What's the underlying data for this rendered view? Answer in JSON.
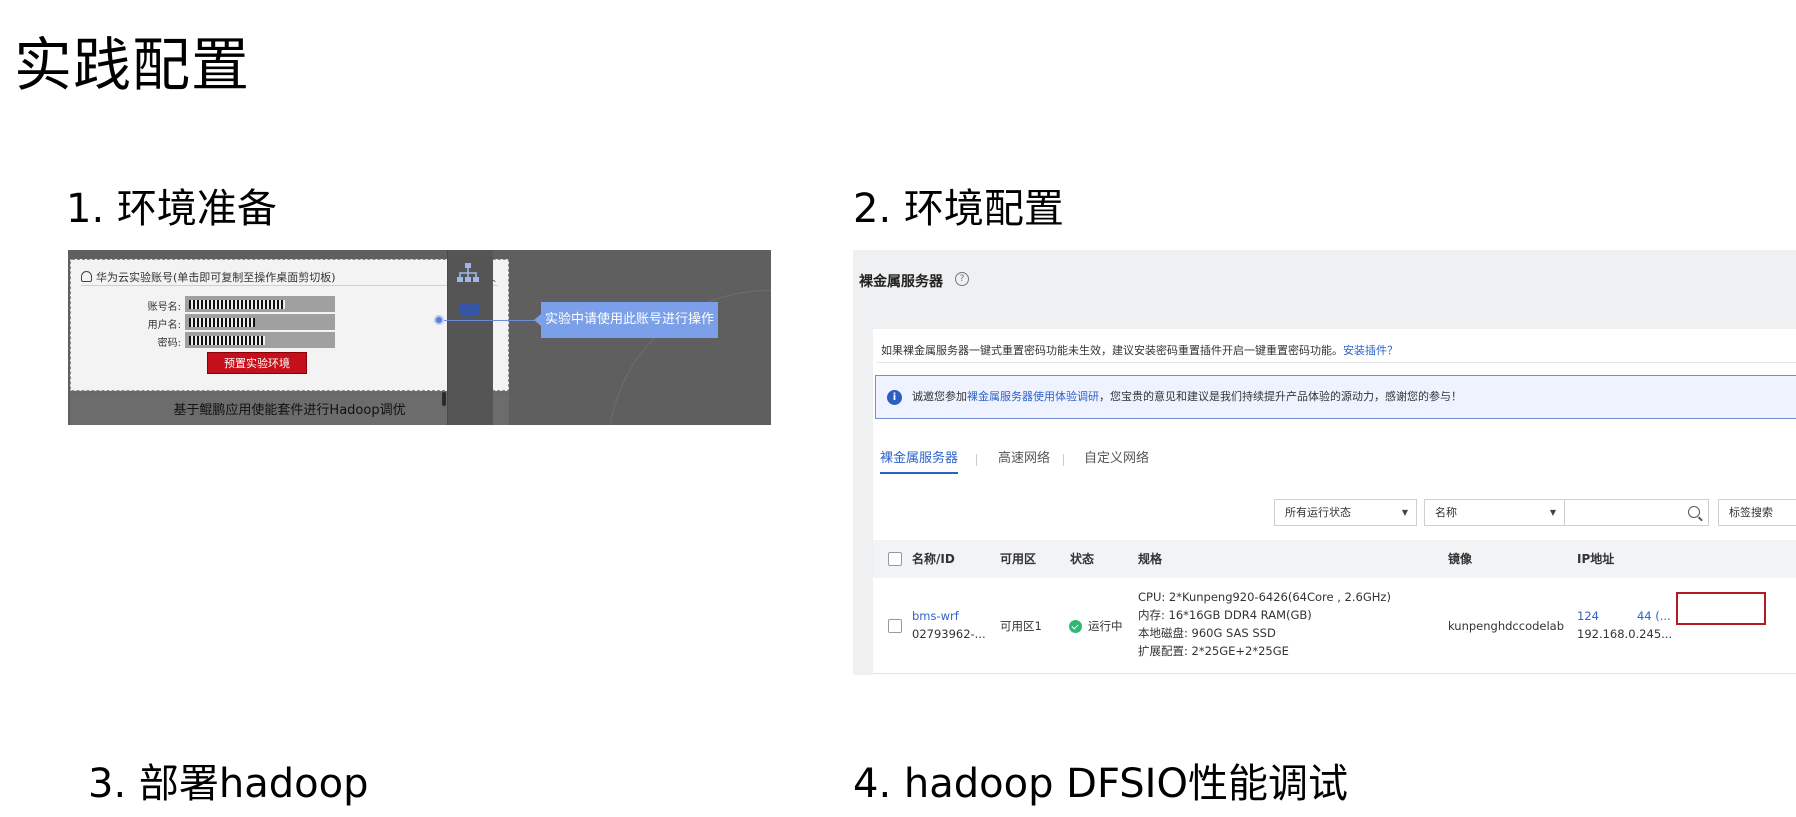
{
  "slide": {
    "title": "实践配置",
    "steps": [
      "1. 环境准备",
      "2. 环境配置",
      "3. 部署hadoop",
      "4. hadoop DFSIO性能调试"
    ]
  },
  "shot1": {
    "popup_header": "华为云实验账号(单击即可复制至操作桌面剪切板)",
    "fields": [
      {
        "label": "账号名:"
      },
      {
        "label": "用户名:"
      },
      {
        "label": "密码:"
      }
    ],
    "reset_button": "预置实验环境",
    "tooltip": "实验中请使用此账号进行操作",
    "course_title": "基于鲲鹏应用使能套件进行Hadoop调优",
    "icons": [
      "user-icon",
      "chevron-up-icon",
      "org-tree-icon",
      "monitor-icon"
    ],
    "colors": {
      "tooltip": "#7b9fe8",
      "reset_button": "#c4101a"
    }
  },
  "shot2": {
    "page_title": "裸金属服务器",
    "help_icon": "?",
    "tip_text": "如果裸金属服务器一键式重置密码功能未生效，建议安装密码重置插件开启一键重置密码功能。",
    "tip_link": "安装插件？",
    "survey_prefix": "诚邀您参加",
    "survey_link": "裸金属服务器使用体验调研",
    "survey_suffix": "，您宝贵的意见和建议是我们持续提升产品体验的源动力，感谢您的参与！",
    "info_icon": "i",
    "tabs": [
      "裸金属服务器",
      "高速网络",
      "自定义网络"
    ],
    "filters": {
      "status_select": "所有运行状态",
      "name_select": "名称",
      "tag_search": "标签搜索"
    },
    "columns": [
      "名称/ID",
      "可用区",
      "状态",
      "规格",
      "镜像",
      "IP地址"
    ],
    "row": {
      "name": "bms-wrf",
      "id": "02793962-...",
      "zone": "可用区1",
      "status": "运行中",
      "spec": [
        "CPU: 2*Kunpeng920-6426(64Core , 2.6GHz)",
        "内存: 16*16GB DDR4 RAM(GB)",
        "本地磁盘: 960G SAS SSD",
        "扩展配置: 2*25GE+2*25GE"
      ],
      "image": "kunpenghdccodelab",
      "ip_public_prefix": "124",
      "ip_public_suffix": "44 (...",
      "ip_private": "192.168.0.245..."
    },
    "colors": {
      "link": "#2d63c8",
      "status_ok": "#2eb872",
      "highlight": "#b51a22"
    }
  }
}
